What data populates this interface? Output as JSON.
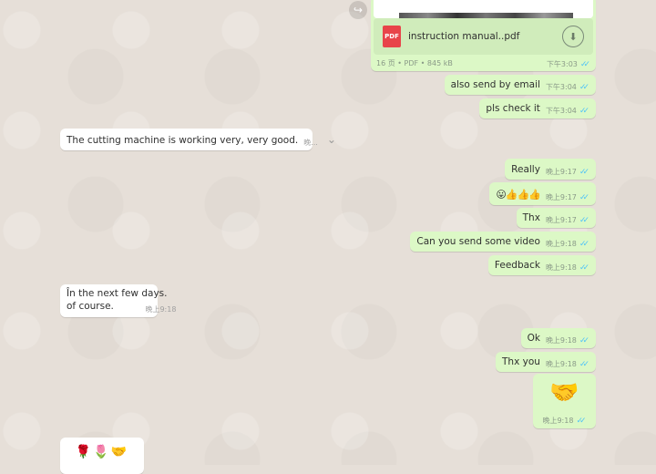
{
  "messages": [
    {
      "dir": "out",
      "type": "file",
      "file_name": "instruction manual..pdf",
      "file_icon": "PDF",
      "file_info": "16 页 • PDF • 845 kB",
      "time": "下午3:03",
      "status": "read"
    },
    {
      "dir": "out",
      "text": "also send by email",
      "time": "下午3:04",
      "status": "read"
    },
    {
      "dir": "out",
      "text": "pls check it",
      "time": "下午3:04",
      "status": "read"
    },
    {
      "dir": "in",
      "text": "The cutting machine is working very, very good.",
      "time": "晚..."
    },
    {
      "dir": "out",
      "text": "Really",
      "time": "晚上9:17",
      "status": "read"
    },
    {
      "dir": "out",
      "text": "😛👍👍👍",
      "time": "晚上9:17",
      "status": "read"
    },
    {
      "dir": "out",
      "text": "Thx",
      "time": "晚上9:17",
      "status": "read"
    },
    {
      "dir": "out",
      "text": "Can you send some video",
      "time": "晚上9:18",
      "status": "read"
    },
    {
      "dir": "out",
      "text": "Feedback",
      "time": "晚上9:18",
      "status": "read"
    },
    {
      "dir": "in",
      "text_line1": "În the next few days.",
      "text_line2": "of course.",
      "time": "晚上9:18"
    },
    {
      "dir": "out",
      "text": "Ok",
      "time": "晚上9:18",
      "status": "read"
    },
    {
      "dir": "out",
      "text": "Thx you",
      "time": "晚上9:18",
      "status": "read"
    },
    {
      "dir": "out",
      "text": "🤝",
      "time": "晚上9:18",
      "status": "read"
    },
    {
      "dir": "in",
      "text": "🌹🌷🤝"
    }
  ],
  "icons": {
    "forward": "↪",
    "download": "⬇",
    "chevron": "⌄",
    "tick": "✓✓"
  },
  "colors": {
    "outgoing": "#dcf8c6",
    "incoming": "#ffffff",
    "read_tick": "#4fc3f7",
    "pdf": "#e8444a"
  }
}
